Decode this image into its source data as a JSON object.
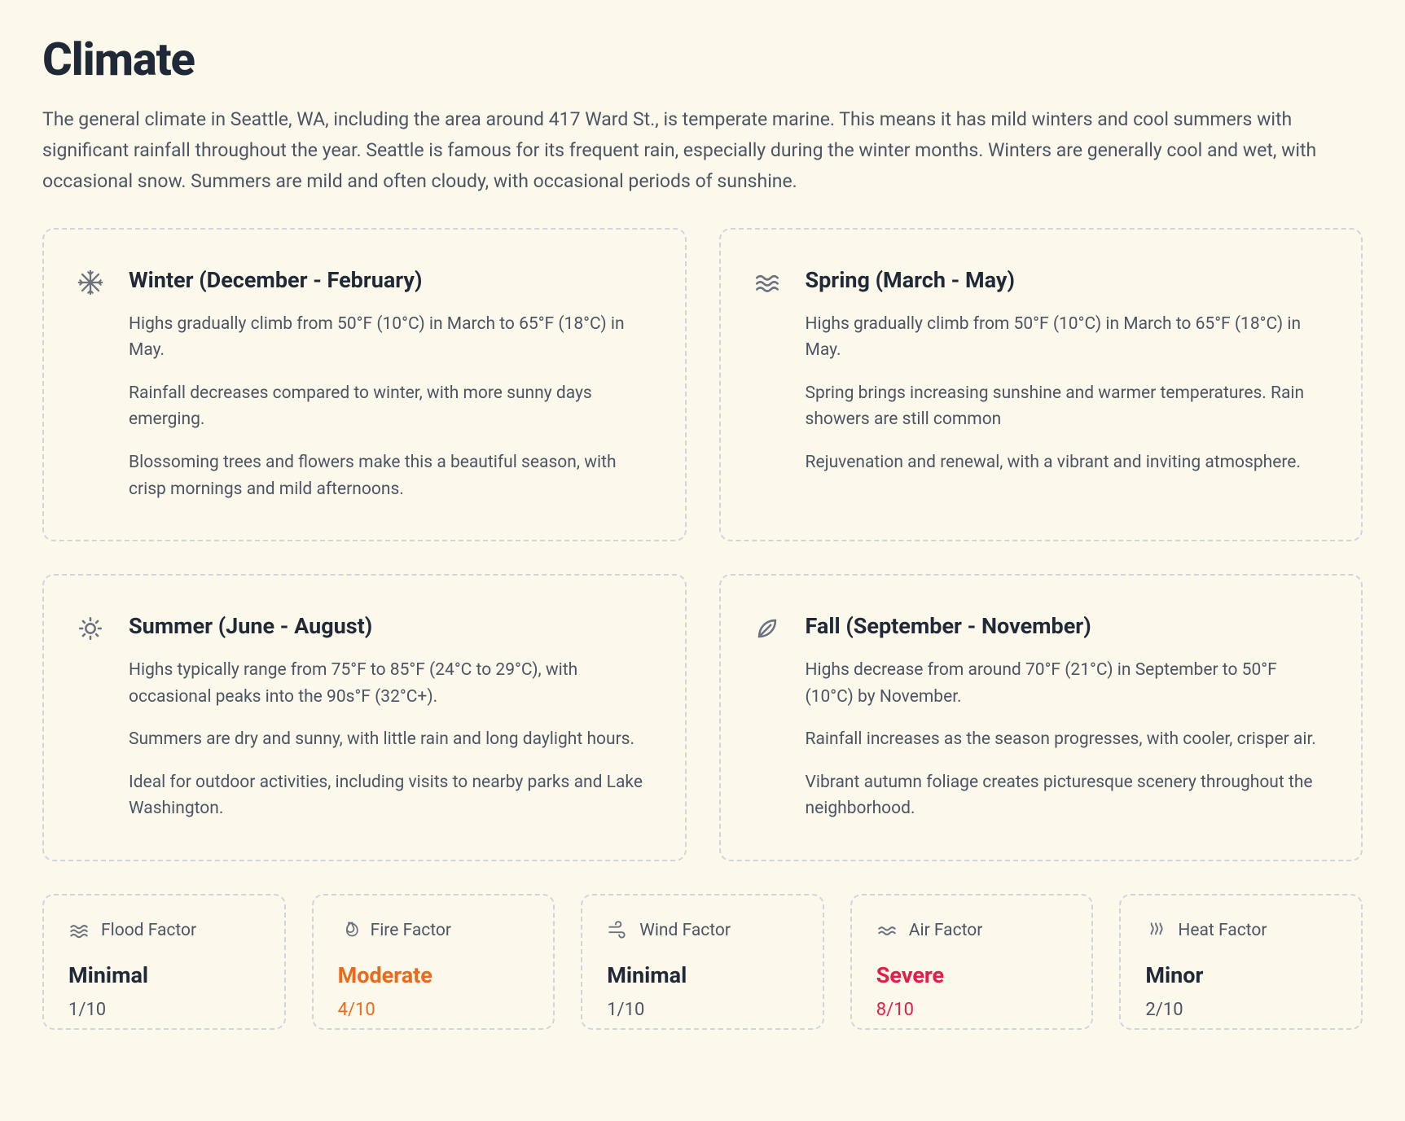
{
  "page": {
    "title": "Climate",
    "intro": "The general climate in Seattle, WA, including the area around 417 Ward St., is temperate marine. This means it has mild winters and cool summers with significant rainfall throughout the year. Seattle is famous for its frequent rain, especially during the winter months. Winters are generally cool and wet, with occasional snow. Summers are mild and often cloudy, with occasional periods of sunshine."
  },
  "seasons": [
    {
      "icon": "snowflake-icon",
      "title": "Winter (December - February)",
      "lines": [
        "Highs gradually climb from 50°F (10°C) in March to 65°F (18°C) in May.",
        "Rainfall decreases compared to winter, with more sunny days emerging.",
        "Blossoming trees and flowers make this a beautiful season, with crisp mornings and mild afternoons."
      ]
    },
    {
      "icon": "waves-icon",
      "title": "Spring (March - May)",
      "lines": [
        "Highs gradually climb from 50°F (10°C) in March to 65°F (18°C) in May.",
        "Spring brings increasing sunshine and warmer temperatures. Rain showers are still common",
        "Rejuvenation and renewal, with a vibrant and inviting atmosphere."
      ]
    },
    {
      "icon": "sun-icon",
      "title": "Summer (June - August)",
      "lines": [
        "Highs typically range from 75°F to 85°F (24°C to 29°C), with occasional peaks into the 90s°F (32°C+).",
        "Summers are dry and sunny, with little rain and long daylight hours.",
        "Ideal for outdoor activities, including visits to nearby parks and Lake Washington."
      ]
    },
    {
      "icon": "leaf-icon",
      "title": "Fall (September - November)",
      "lines": [
        "Highs decrease from around 70°F (21°C) in September to 50°F (10°C) by November.",
        "Rainfall increases as the season progresses, with cooler, crisper air.",
        "Vibrant autumn foliage creates picturesque scenery throughout the neighborhood."
      ]
    }
  ],
  "factors": [
    {
      "icon": "waves-icon",
      "label": "Flood Factor",
      "verdict": "Minimal",
      "score": "1/10",
      "verdict_class": ""
    },
    {
      "icon": "fire-icon",
      "label": "Fire Factor",
      "verdict": "Moderate",
      "score": "4/10",
      "verdict_class": "c-orange"
    },
    {
      "icon": "wind-icon",
      "label": "Wind Factor",
      "verdict": "Minimal",
      "score": "1/10",
      "verdict_class": ""
    },
    {
      "icon": "air-icon",
      "label": "Air Factor",
      "verdict": "Severe",
      "score": "8/10",
      "verdict_class": "c-red"
    },
    {
      "icon": "heat-icon",
      "label": "Heat Factor",
      "verdict": "Minor",
      "score": "2/10",
      "verdict_class": ""
    }
  ]
}
